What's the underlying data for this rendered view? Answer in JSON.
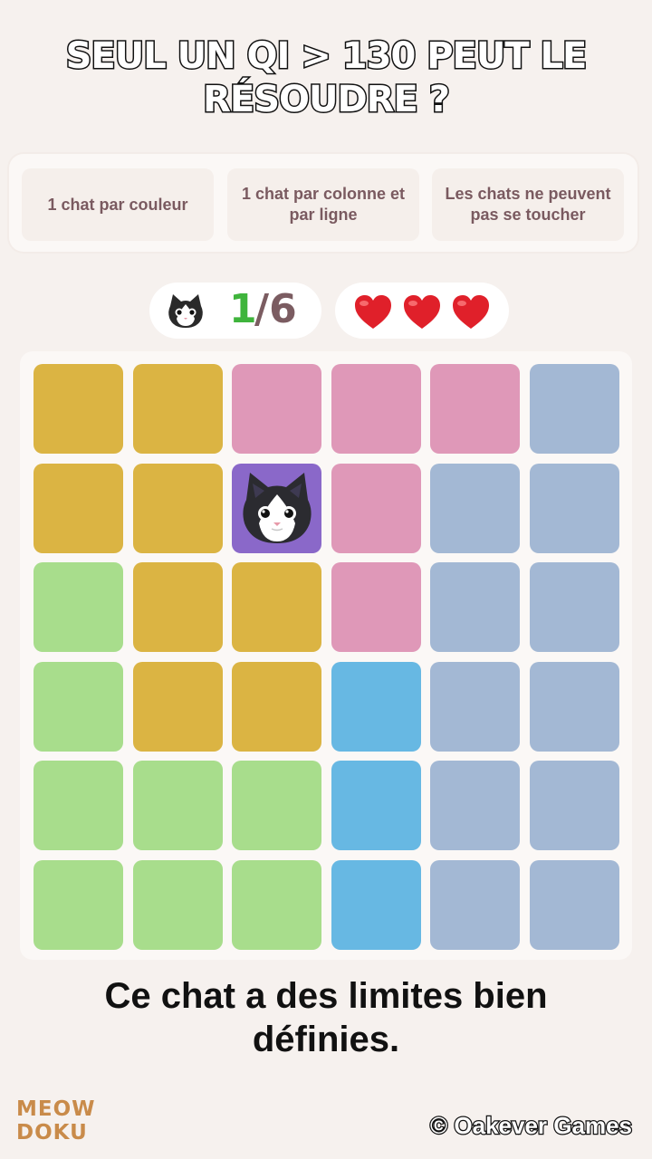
{
  "headline": "SEUL UN QI > 130 PEUT LE RÉSOUDRE ?",
  "rules": [
    "1 chat par couleur",
    "1 chat par colonne et par ligne",
    "Les chats ne peuvent pas se toucher"
  ],
  "counter": {
    "current": "1",
    "separator": "/6",
    "icon": "cat-face-icon"
  },
  "lives": {
    "count": 3,
    "icon": "heart-icon"
  },
  "colors": {
    "yellow": "#dbb443",
    "pink": "#df98b8",
    "slate": "#a3b8d4",
    "green": "#a8dd8c",
    "blue": "#67b8e3",
    "purple": "#8a68c9"
  },
  "grid": [
    [
      "yellow",
      "yellow",
      "pink",
      "pink",
      "pink",
      "slate"
    ],
    [
      "yellow",
      "yellow",
      "purple",
      "pink",
      "slate",
      "slate"
    ],
    [
      "green",
      "yellow",
      "yellow",
      "pink",
      "slate",
      "slate"
    ],
    [
      "green",
      "yellow",
      "yellow",
      "blue",
      "slate",
      "slate"
    ],
    [
      "green",
      "green",
      "green",
      "blue",
      "slate",
      "slate"
    ],
    [
      "green",
      "green",
      "green",
      "blue",
      "slate",
      "slate"
    ]
  ],
  "cats": [
    {
      "row": 1,
      "col": 2
    }
  ],
  "caption": "Ce chat a des limites bien définies.",
  "logo": {
    "line1": "MEOW",
    "line2": "DOKU"
  },
  "copyright": "© Oakever Games"
}
